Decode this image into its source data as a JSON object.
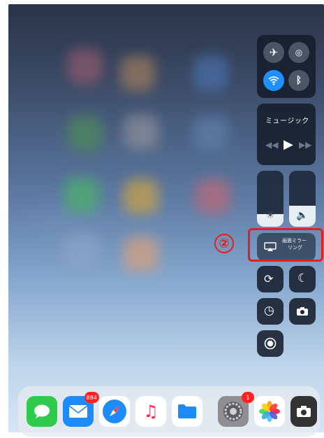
{
  "control_center": {
    "music": {
      "title": "ミュージック",
      "prev_icon": "rewind-icon",
      "play_icon": "play-icon",
      "next_icon": "fast-forward-icon"
    },
    "connectivity": {
      "airplane_icon": "airplane-icon",
      "airdrop_icon": "airdrop-icon",
      "wifi_icon": "wifi-icon",
      "wifi_state": "on",
      "bluetooth_icon": "bluetooth-icon"
    },
    "brightness_level": 0.22,
    "volume_level": 0.38,
    "screen_mirroring": {
      "label_line1": "画面ミラー",
      "label_line2": "リング"
    },
    "accent_color": "#1e90ff"
  },
  "annotation": {
    "marker": "②",
    "color": "#e61e1e"
  },
  "dock": {
    "apps": [
      {
        "name": "Messages",
        "icon": "messages-icon",
        "color": "#2fcb4c"
      },
      {
        "name": "Mail",
        "icon": "mail-icon",
        "color": "#1d8cf8",
        "badge": "884"
      },
      {
        "name": "Safari",
        "icon": "safari-icon",
        "color": "#1d8cf8"
      },
      {
        "name": "Music",
        "icon": "music-icon",
        "color": "#ffffff"
      },
      {
        "name": "Files",
        "icon": "files-icon",
        "color": "#1d8cf8"
      },
      {
        "name": "Settings",
        "icon": "settings-icon",
        "color": "#8e8e93",
        "badge": "1"
      },
      {
        "name": "Photos",
        "icon": "photos-icon",
        "color": "#ffffff"
      },
      {
        "name": "Camera",
        "icon": "camera-icon",
        "color": "#333333"
      }
    ]
  }
}
